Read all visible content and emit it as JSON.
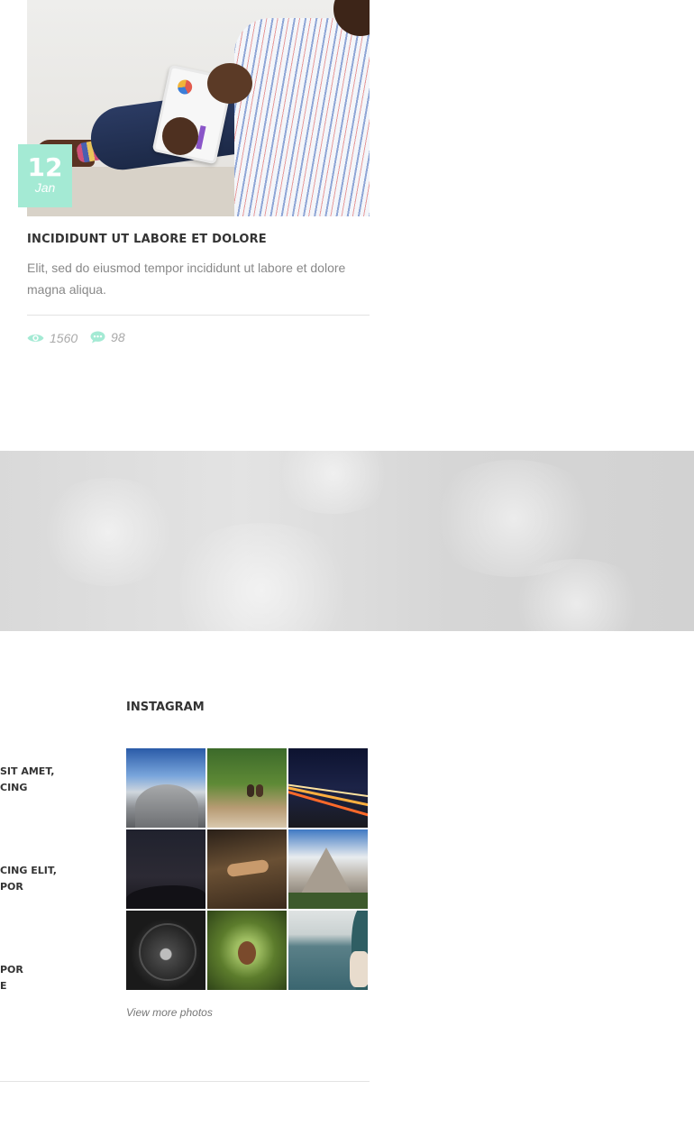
{
  "post": {
    "date_day": "12",
    "date_month": "Jan",
    "title": "INCIDIDUNT UT LABORE ET DOLORE",
    "excerpt": "Elit, sed do eiusmod tempor incididunt ut labore et dolore magna aliqua.",
    "views": "1560",
    "comments": "98",
    "accent_color": "#a4ead4"
  },
  "recent_posts_cut": [
    {
      "line1": "SIT AMET,",
      "line2": "CING"
    },
    {
      "line1": "CING ELIT,",
      "line2": "POR"
    },
    {
      "line1": "POR",
      "line2": "E"
    }
  ],
  "instagram": {
    "title": "INSTAGRAM",
    "photos": [
      "snowy-mountain-dome",
      "couple-on-cliff",
      "night-highway-light-trails",
      "starry-night-sky",
      "blurred-figure-on-wood",
      "rocky-alpine-peaks",
      "dark-tunnel",
      "pine-cone-branch",
      "sea-and-woman-hair"
    ],
    "view_more": "View more photos"
  }
}
